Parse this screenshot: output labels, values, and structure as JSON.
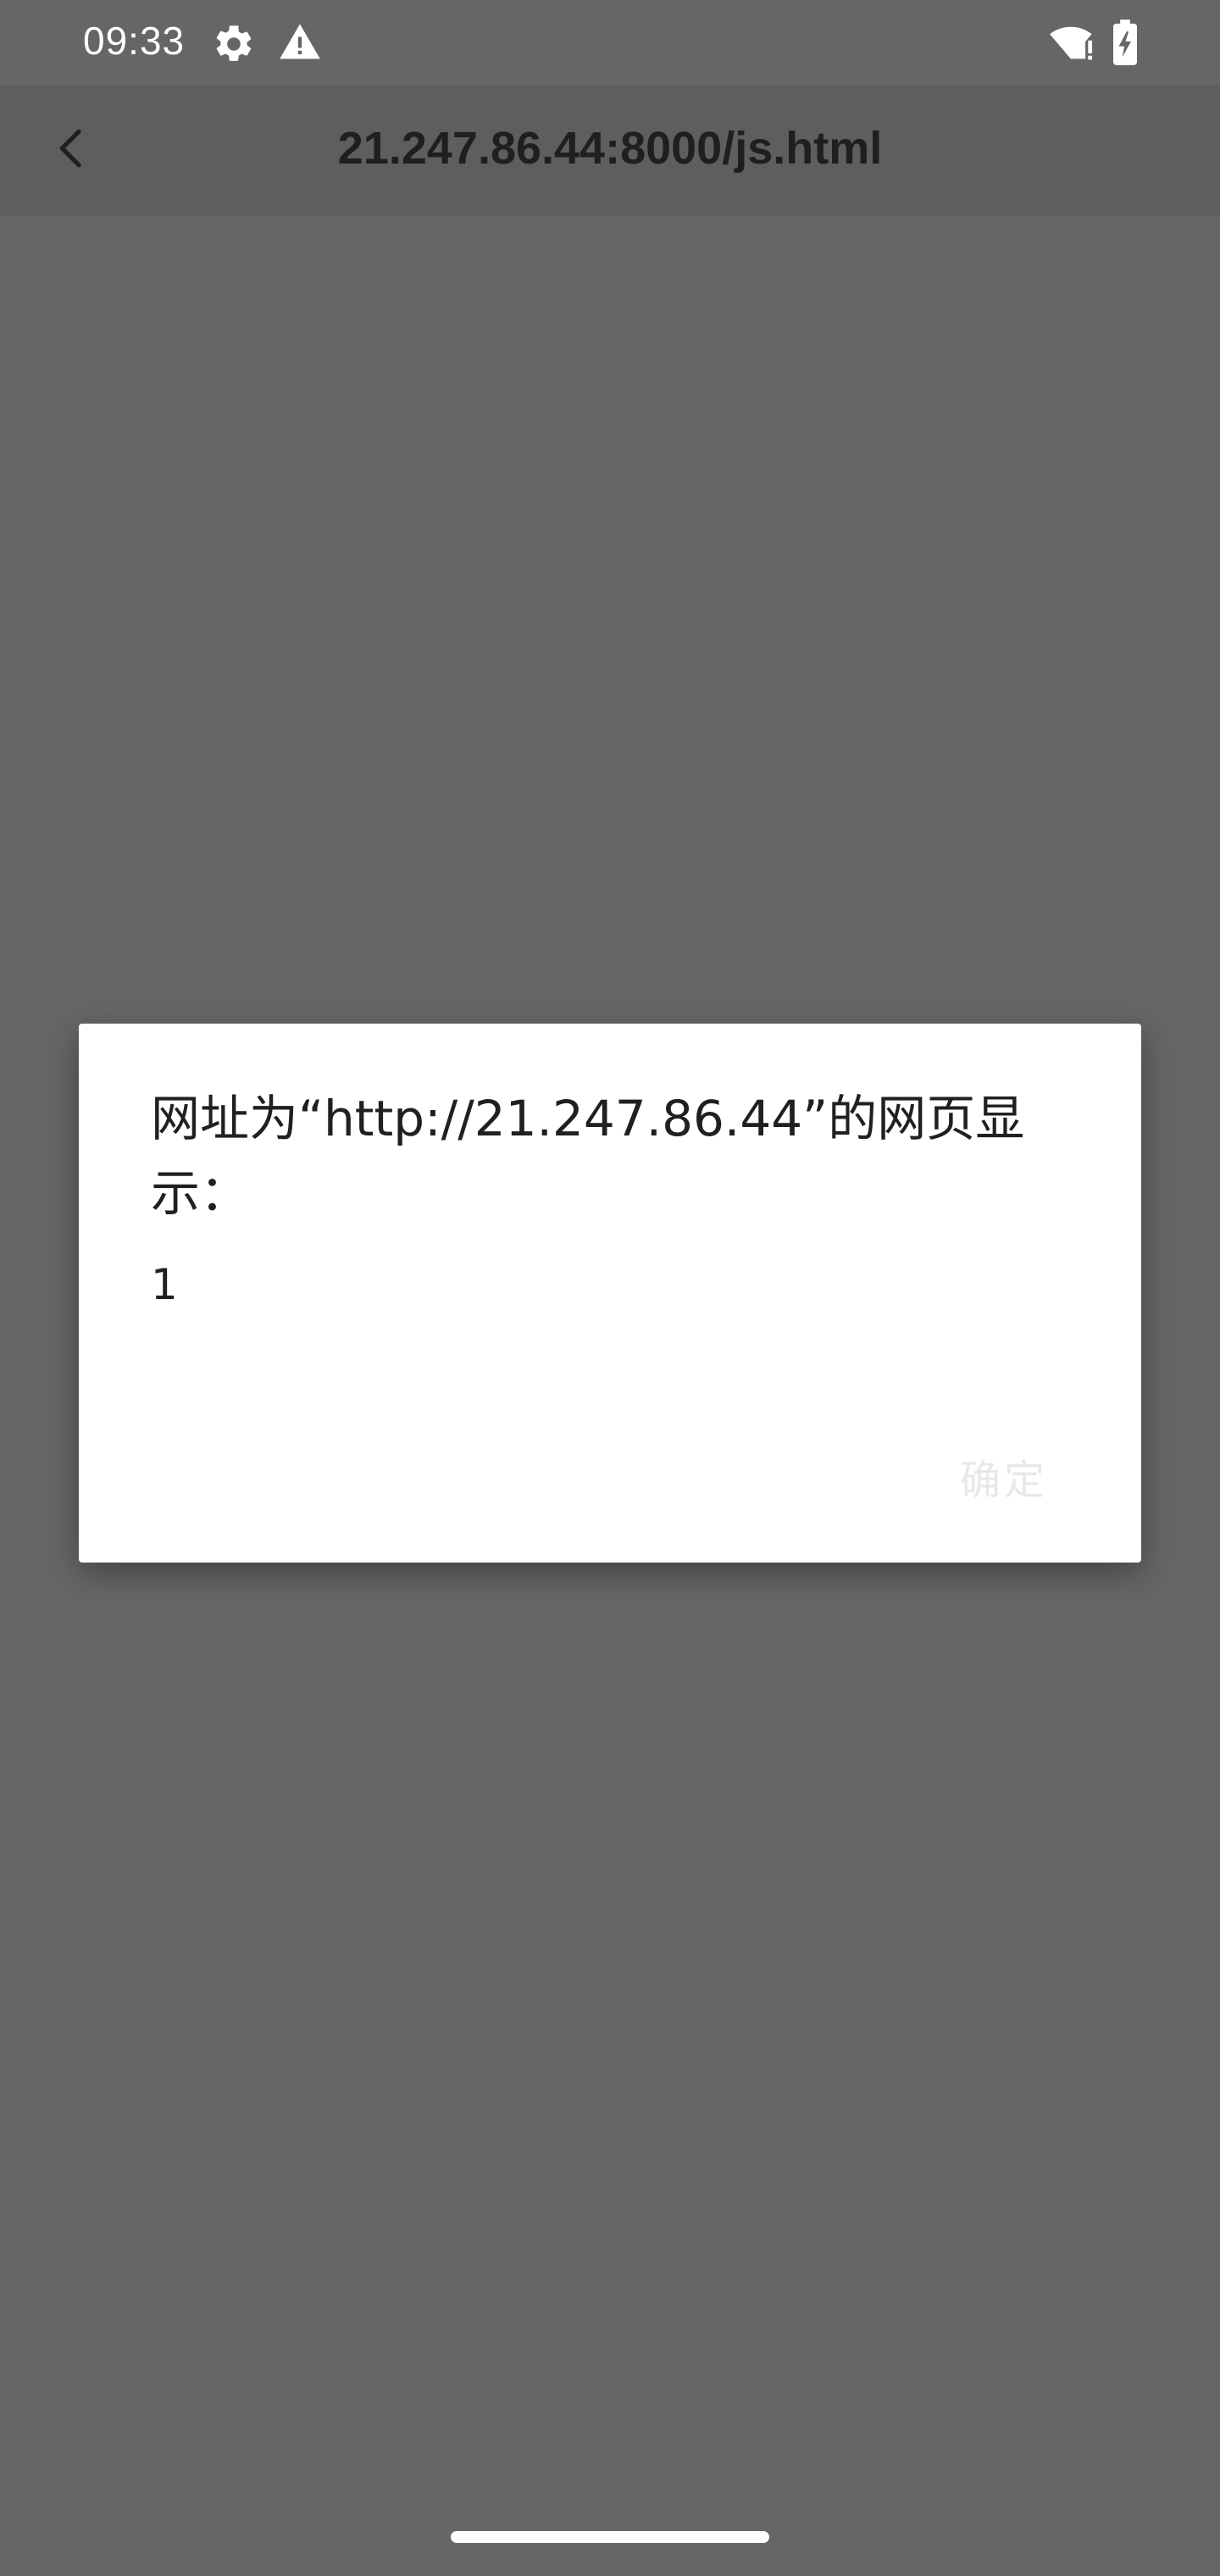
{
  "status_bar": {
    "time": "09:33",
    "icons": [
      "settings-icon",
      "warning-icon",
      "wifi-alert-icon",
      "battery-charging-icon"
    ]
  },
  "app_bar": {
    "back_icon": "back-arrow-icon",
    "title": "21.247.86.44:8000/js.html"
  },
  "dialog": {
    "title": "网址为“http://21.247.86.44”的网页显示：",
    "message": "1",
    "ok_label": "确定"
  },
  "colors": {
    "background_scrim": "#666666",
    "app_bar": "#5e5e5e",
    "dialog_bg": "#ffffff",
    "ok_text": "#e8e8e8"
  }
}
